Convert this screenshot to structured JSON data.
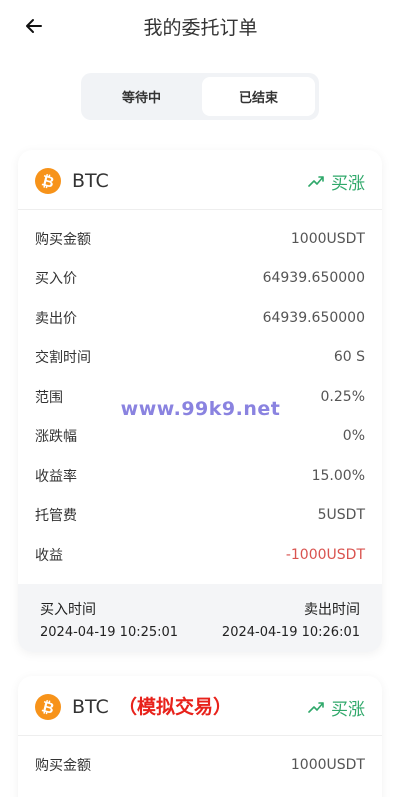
{
  "header": {
    "title": "我的委托订单"
  },
  "tabs": [
    {
      "label": "等待中"
    },
    {
      "label": "已结束"
    }
  ],
  "colors": {
    "up": "#2fa86a",
    "negative": "#d9534f",
    "bitcoin": "#f7931a",
    "warning": "#e8221b"
  },
  "orders": [
    {
      "coin": "BTC",
      "coin_icon": "bitcoin-icon",
      "direction_icon": "trend-up-icon",
      "direction": "买涨",
      "rows": [
        {
          "label": "购买金额",
          "value": "1000USDT"
        },
        {
          "label": "买入价",
          "value": "64939.650000"
        },
        {
          "label": "卖出价",
          "value": "64939.650000"
        },
        {
          "label": "交割时间",
          "value": "60 S"
        },
        {
          "label": "范围",
          "value": "0.25%"
        },
        {
          "label": "涨跌幅",
          "value": "0%"
        },
        {
          "label": "收益率",
          "value": "15.00%"
        },
        {
          "label": "托管费",
          "value": "5USDT"
        },
        {
          "label": "收益",
          "value": "-1000USDT"
        }
      ],
      "buy_time_label": "买入时间",
      "buy_time": "2024-04-19 10:25:01",
      "sell_time_label": "卖出时间",
      "sell_time": "2024-04-19 10:26:01"
    },
    {
      "coin": "BTC",
      "note": "（模拟交易）",
      "direction": "买涨",
      "rows": [
        {
          "label": "购买金额",
          "value": "1000USDT"
        }
      ]
    }
  ],
  "watermark": "www.99k9.net"
}
